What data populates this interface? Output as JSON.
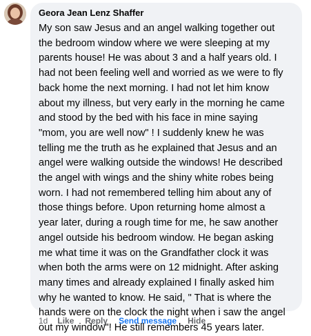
{
  "comment": {
    "author": "Geora Jean Lenz Shaffer",
    "lines": [
      "My son saw Jesus and an angel walking together out",
      "the bedroom window where we were sleeping at my",
      "parents house! He was about 3 and a half years old. I",
      "had not been feeling well and worried as we were to fly",
      "back home the next morning. I had not let him know",
      "about my illness, but very early in the morning he came",
      "and stood by the bed with his face in mine saying",
      "\"mom, you are well now\" ! I suddenly knew he was",
      "telling me the truth as he explained that Jesus and an",
      "angel were walking outside the windows! He described",
      "the angel with wings and the shiny white robes being",
      "worn. I had not remembered telling him about any of",
      "those things before. Upon returning home almost a",
      "year later, during a rough time for me, he saw another",
      "angel outside his bedroom window. He began asking",
      "me what time it was on the Grandfather clock it was",
      "when both the arms were on 12 midnight. After asking",
      "many times and already explained I finally asked him",
      "why he wanted to know. He said, \" That is where the",
      "hands were on the clock the night when i saw the angel",
      "out my window\"! He still remembers 45 years later."
    ]
  },
  "actions": {
    "time": "1d",
    "like": "Like",
    "reply": "Reply",
    "send_message": "Send message",
    "hide": "Hide"
  },
  "colors": {
    "bubble": "#f0f2f5",
    "text": "#050505",
    "muted": "#65676b",
    "link": "#1877f2"
  }
}
